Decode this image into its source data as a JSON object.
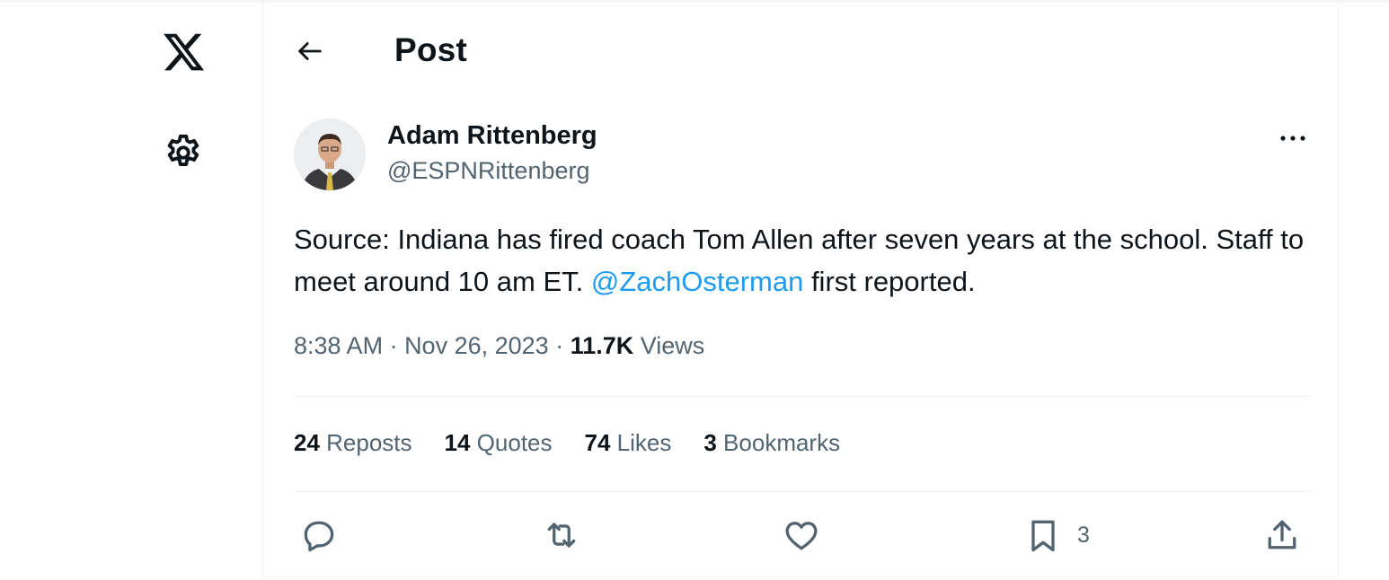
{
  "header": {
    "title": "Post"
  },
  "tweet": {
    "author_name": "Adam Rittenberg",
    "author_handle": "@ESPNRittenberg",
    "text_before": "Source: Indiana has fired coach Tom Allen after seven years at the school. Staff to meet around 10 am ET. ",
    "mention": "@ZachOsterman",
    "text_after": " first reported.",
    "time": "8:38 AM",
    "separator": " · ",
    "date": "Nov 26, 2023",
    "views_count": "11.7K",
    "views_label": " Views"
  },
  "stats": [
    {
      "count": "24",
      "label": " Reposts"
    },
    {
      "count": "14",
      "label": " Quotes"
    },
    {
      "count": "74",
      "label": " Likes"
    },
    {
      "count": "3",
      "label": " Bookmarks"
    }
  ],
  "actions": {
    "bookmark_count": "3"
  },
  "icons": [
    "x-logo-icon",
    "settings-gear-icon",
    "back-arrow-icon",
    "more-options-icon",
    "reply-icon",
    "repost-icon",
    "like-heart-icon",
    "bookmark-icon",
    "share-upload-icon"
  ],
  "colors": {
    "accent": "#1d9bf0",
    "text": "#0f1419",
    "secondary": "#536471",
    "divider": "#eff3f4"
  }
}
